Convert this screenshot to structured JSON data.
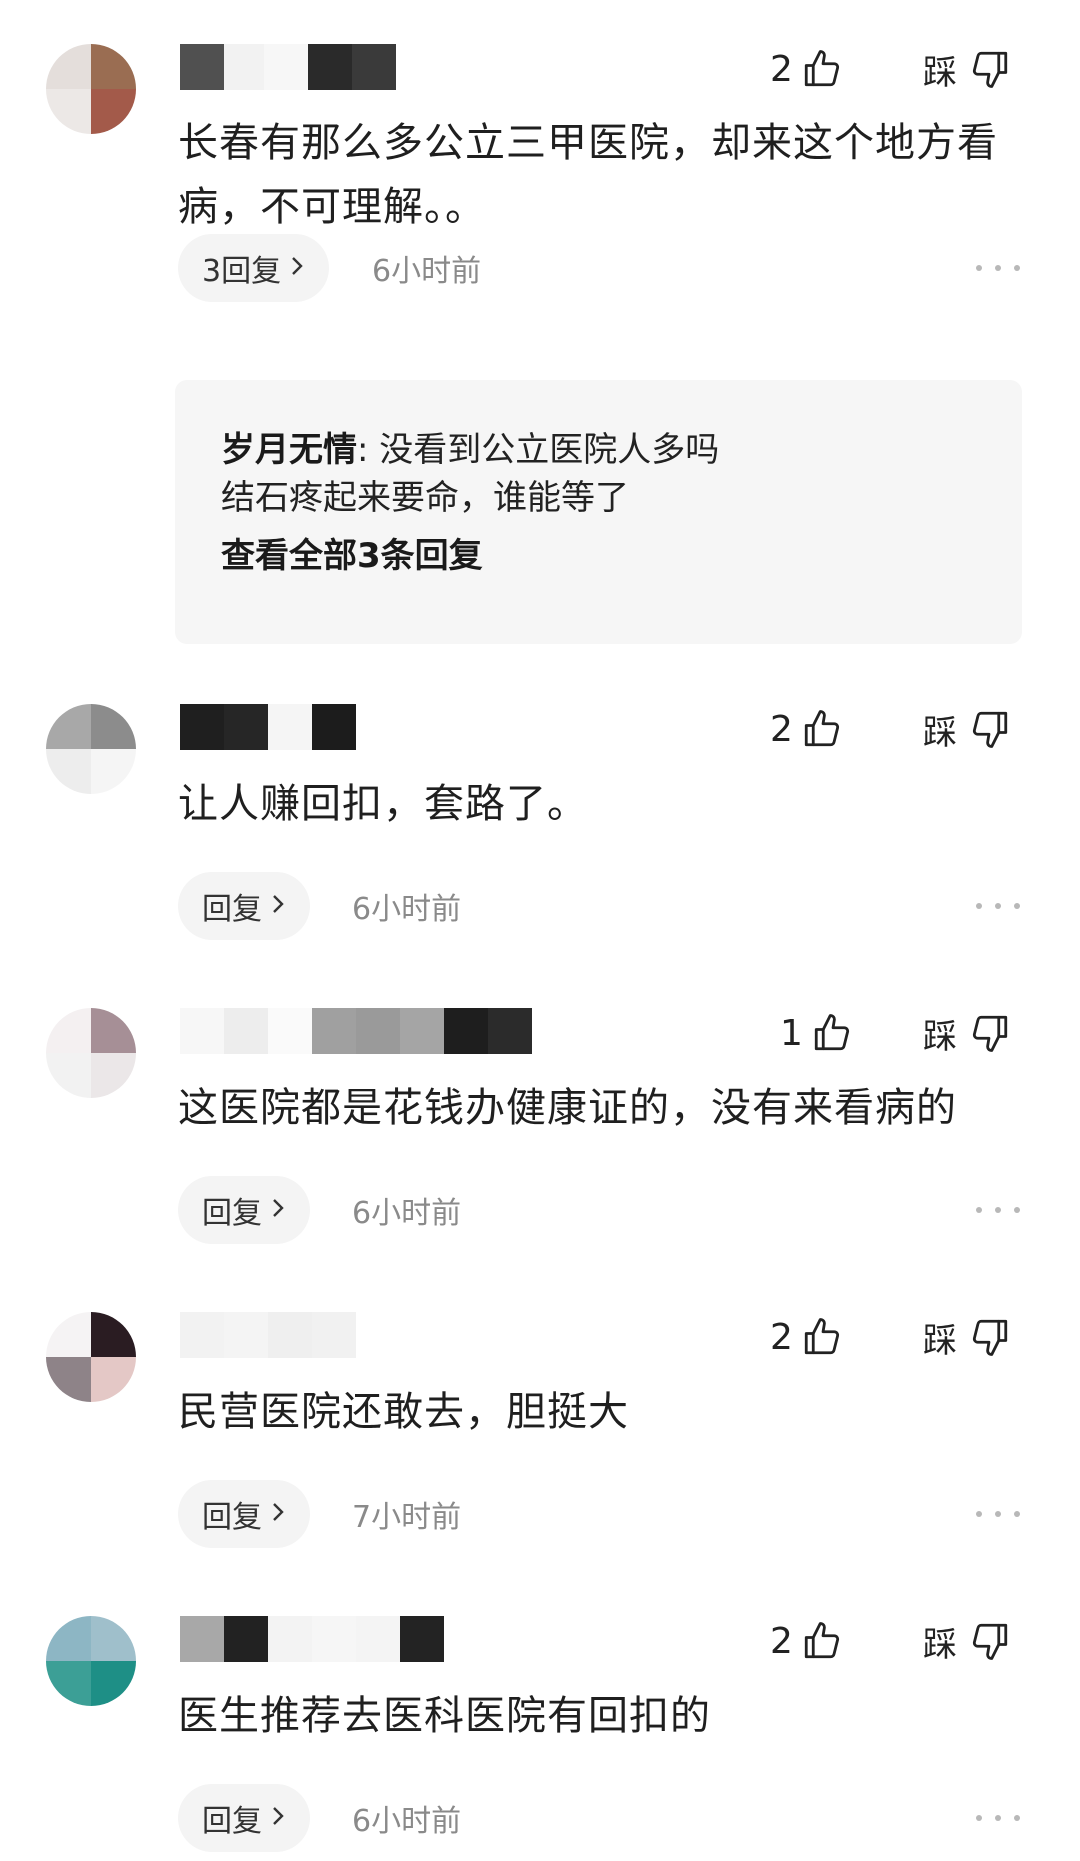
{
  "dislike_label": "踩",
  "reply_thread": {
    "author": "岁月无情",
    "separator": ": ",
    "text_line1": "没看到公立医院人多吗",
    "text_line2": "结石疼起来要命，谁能等了",
    "view_all": "查看全部3条回复"
  },
  "comments": [
    {
      "content": "长春有那么多公立三甲医院，却来这个地方看病，不可理解。。",
      "likes": "2",
      "reply_label": "3回复",
      "time": "6小时前"
    },
    {
      "content": "让人赚回扣，套路了。",
      "likes": "2",
      "reply_label": "回复",
      "time": "6小时前"
    },
    {
      "content": "这医院都是花钱办健康证的，没有来看病的",
      "likes": "1",
      "reply_label": "回复",
      "time": "6小时前"
    },
    {
      "content": "民营医院还敢去，胆挺大",
      "likes": "2",
      "reply_label": "回复",
      "time": "7小时前"
    },
    {
      "content": "医生推荐去医科医院有回扣的",
      "likes": "2",
      "reply_label": "回复",
      "time": "6小时前"
    }
  ]
}
